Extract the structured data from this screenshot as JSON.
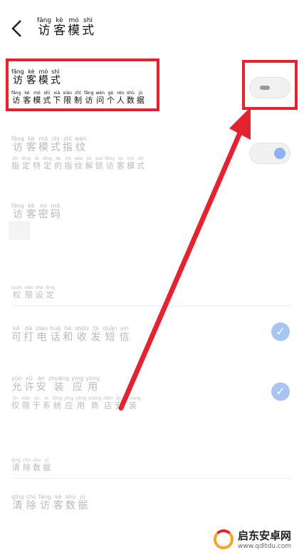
{
  "header": {
    "back_icon": "chevron-left-icon",
    "title": [
      [
        "fǎng",
        "访"
      ],
      [
        "kè",
        "客"
      ],
      [
        "mó",
        "模"
      ],
      [
        "shì",
        "式"
      ]
    ]
  },
  "guest_mode": {
    "title": [
      [
        "fǎng",
        "访"
      ],
      [
        "kè",
        "客"
      ],
      [
        "mó",
        "模"
      ],
      [
        "shì",
        "式"
      ]
    ],
    "desc": [
      [
        "fǎng",
        "访"
      ],
      [
        "kè",
        "客"
      ],
      [
        "mó",
        "模"
      ],
      [
        "shì",
        "式"
      ],
      [
        "xià",
        "下"
      ],
      [
        "xiàn",
        "限"
      ],
      [
        "zhì",
        "制"
      ],
      [
        "fǎng",
        "访"
      ],
      [
        "wèn",
        "问"
      ],
      [
        "gè",
        "个"
      ],
      [
        "rén",
        "人"
      ],
      [
        "shù",
        "数"
      ],
      [
        "jù",
        "据"
      ]
    ],
    "toggle_state": "off"
  },
  "fingerprint": {
    "title": [
      [
        "fǎng",
        "访"
      ],
      [
        "kè",
        "客"
      ],
      [
        "mó",
        "模"
      ],
      [
        "shì",
        "式"
      ],
      [
        "zhǐ",
        "指"
      ],
      [
        "wén",
        "纹"
      ]
    ],
    "desc": [
      [
        "zhǐ",
        "指"
      ],
      [
        "dìng",
        "定"
      ],
      [
        "tè",
        "特"
      ],
      [
        "dìng",
        "定"
      ],
      [
        "de",
        "的"
      ],
      [
        "zhǐ",
        "指"
      ],
      [
        "wén",
        "纹"
      ],
      [
        "jiě",
        "解"
      ],
      [
        "suǒ",
        "锁"
      ],
      [
        "fǎng",
        "访"
      ],
      [
        "kè",
        "客"
      ],
      [
        "mó",
        "模"
      ],
      [
        "shì",
        "式"
      ]
    ],
    "toggle_state": "on"
  },
  "password": {
    "title": [
      [
        "fǎng",
        "访"
      ],
      [
        "kè",
        "客"
      ],
      [
        "mì",
        "密"
      ],
      [
        "mǎ",
        "码"
      ]
    ]
  },
  "permission_section": {
    "title": [
      [
        "quán",
        "权"
      ],
      [
        "xiàn",
        "限"
      ],
      [
        "shè",
        "设"
      ],
      [
        "dìng",
        "定"
      ]
    ]
  },
  "calls": {
    "title": [
      [
        "kě",
        "可"
      ],
      [
        "dǎ",
        "打"
      ],
      [
        "diàn",
        "电"
      ],
      [
        "huà",
        "话"
      ],
      [
        "hé",
        "和"
      ],
      [
        "shōu",
        "收"
      ],
      [
        "fā",
        "发"
      ],
      [
        "duǎn",
        "短"
      ],
      [
        "xìn",
        "信"
      ]
    ],
    "checked": true
  },
  "install": {
    "title": [
      [
        "yǔn",
        "允"
      ],
      [
        "xǔ",
        "许"
      ],
      [
        "ān",
        "安"
      ],
      [
        "zhuāng",
        "装"
      ],
      [
        "yìng",
        "应"
      ],
      [
        "yòng",
        "用"
      ]
    ],
    "desc": [
      [
        "jǐn",
        "仅"
      ],
      [
        "xiàn",
        "限"
      ],
      [
        "yú",
        "于"
      ],
      [
        "xì",
        "系"
      ],
      [
        "tǒng",
        "统"
      ],
      [
        "yìng",
        "应"
      ],
      [
        "yòng",
        "用"
      ],
      [
        "shāng",
        "商"
      ],
      [
        "diàn",
        "店"
      ],
      [
        "ān",
        "安"
      ],
      [
        "zhuāng",
        "装"
      ]
    ],
    "checked": true
  },
  "clear_section": {
    "title": [
      [
        "qīng",
        "清"
      ],
      [
        "chú",
        "除"
      ],
      [
        "shù",
        "数"
      ],
      [
        "jù",
        "据"
      ]
    ]
  },
  "clear_guest": {
    "title": [
      [
        "qīng",
        "清"
      ],
      [
        "chú",
        "除"
      ],
      [
        "fǎng",
        "访"
      ],
      [
        "kè",
        "客"
      ],
      [
        "shù",
        "数"
      ],
      [
        "jù",
        "据"
      ]
    ]
  },
  "watermark": {
    "name": "启东安卓网",
    "url": "www.qdltdu.com"
  },
  "colors": {
    "highlight": "#e5222f",
    "accent": "#8fb3f2"
  }
}
